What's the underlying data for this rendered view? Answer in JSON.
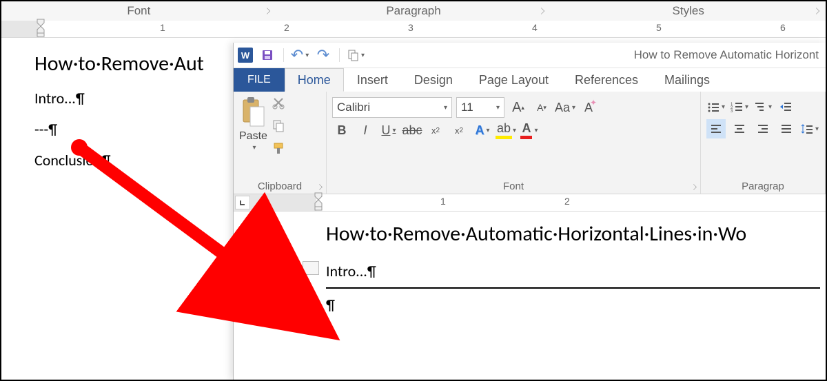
{
  "back": {
    "groups": [
      "Font",
      "Paragraph",
      "Styles"
    ],
    "ruler_ticks": [
      "1",
      "2",
      "3",
      "4",
      "5",
      "6"
    ],
    "doc": {
      "title": "How·to·Remove·Aut",
      "intro": "Intro...¶",
      "dashes": "---¶",
      "conclusion": "Conclusion¶"
    }
  },
  "front": {
    "qat": {
      "undo": "↶",
      "redo": "↷",
      "title": "How to Remove Automatic Horizont"
    },
    "tabs": {
      "file": "FILE",
      "home": "Home",
      "insert": "Insert",
      "design": "Design",
      "page_layout": "Page Layout",
      "references": "References",
      "mailings": "Mailings"
    },
    "clipboard": {
      "paste": "Paste",
      "label": "Clipboard"
    },
    "font": {
      "name": "Calibri",
      "size": "11",
      "label": "Font",
      "bold": "B",
      "italic": "I",
      "underline": "U",
      "strike": "abc",
      "sub": "x",
      "sup": "x",
      "Aa": "Aa",
      "bigA": "A",
      "smallA": "A",
      "effects": "A",
      "highlight": "ab",
      "color": "A"
    },
    "para": {
      "label": "Paragrap"
    },
    "ruler_ticks": [
      "1",
      "2"
    ],
    "doc": {
      "title": "How·to·Remove·Automatic·Horizontal·Lines·in·Wo",
      "intro": "Intro...¶",
      "blank": "¶"
    }
  }
}
